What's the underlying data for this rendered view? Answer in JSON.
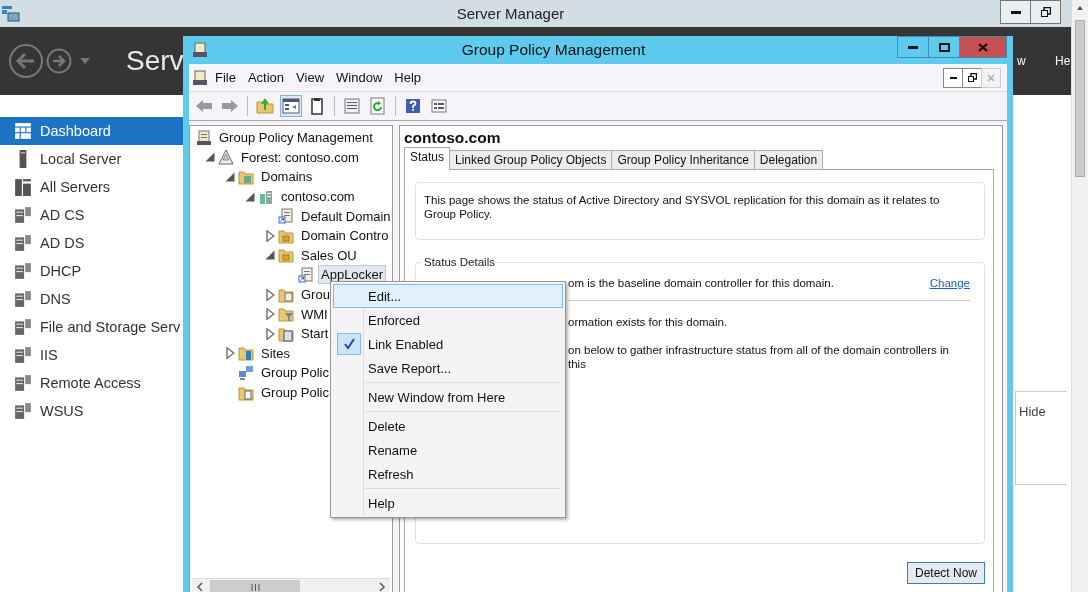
{
  "server_manager": {
    "title": "Server Manager",
    "header_title": "Serv",
    "menu_fragments": [
      "w",
      "He"
    ],
    "sidebar": [
      {
        "label": "Dashboard",
        "selected": true
      },
      {
        "label": "Local Server",
        "selected": false
      },
      {
        "label": "All Servers",
        "selected": false
      },
      {
        "label": "AD CS",
        "selected": false
      },
      {
        "label": "AD DS",
        "selected": false
      },
      {
        "label": "DHCP",
        "selected": false
      },
      {
        "label": "DNS",
        "selected": false
      },
      {
        "label": "File and Storage Serv",
        "selected": false
      },
      {
        "label": "IIS",
        "selected": false
      },
      {
        "label": "Remote Access",
        "selected": false
      },
      {
        "label": "WSUS",
        "selected": false
      }
    ],
    "hide_link": "Hide"
  },
  "gpm_window": {
    "title": "Group Policy Management",
    "menu": [
      "File",
      "Action",
      "View",
      "Window",
      "Help"
    ],
    "tree": [
      {
        "label": "Group Policy Management",
        "kind": "root",
        "selected": false,
        "children": [
          {
            "label": "Forest: contoso.com",
            "kind": "forest",
            "selected": false,
            "expanded": true,
            "children": [
              {
                "label": "Domains",
                "kind": "domains",
                "selected": false,
                "expanded": true,
                "children": [
                  {
                    "label": "contoso.com",
                    "kind": "domain",
                    "selected": false,
                    "expanded": true,
                    "children": [
                      {
                        "label": "Default Domain",
                        "kind": "gpo-link",
                        "selected": false
                      },
                      {
                        "label": "Domain Contro",
                        "kind": "ou",
                        "selected": false,
                        "expanded": false
                      },
                      {
                        "label": "Sales OU",
                        "kind": "ou",
                        "selected": false,
                        "expanded": true,
                        "children": [
                          {
                            "label": "AppLocker",
                            "kind": "gpo-link",
                            "selected": true
                          }
                        ]
                      },
                      {
                        "label": "Grou",
                        "kind": "gpos",
                        "selected": false,
                        "expanded": false
                      },
                      {
                        "label": "WMI",
                        "kind": "wmi",
                        "selected": false,
                        "expanded": false
                      },
                      {
                        "label": "Start",
                        "kind": "starter",
                        "selected": false,
                        "expanded": false
                      }
                    ]
                  }
                ]
              },
              {
                "label": "Sites",
                "kind": "sites",
                "selected": false,
                "expanded": false
              },
              {
                "label": "Group Polic",
                "kind": "modeling",
                "selected": false
              },
              {
                "label": "Group Polic",
                "kind": "results",
                "selected": false
              }
            ]
          }
        ]
      }
    ],
    "details": {
      "heading": "contoso.com",
      "tabs": [
        {
          "label": "Status",
          "selected": true
        },
        {
          "label": "Linked Group Policy Objects",
          "selected": false
        },
        {
          "label": "Group Policy Inheritance",
          "selected": false
        },
        {
          "label": "Delegation",
          "selected": false
        }
      ],
      "description": "This page shows the status of Active Directory and SYSVOL replication for this domain as it relates to Group Policy.",
      "status_details_title": "Status Details",
      "baseline_line": "om is the baseline domain controller for this domain.",
      "change_link": "Change",
      "lines": [
        "ormation exists for this domain.",
        "on below to gather infrastructure status from all of the domain controllers in this"
      ],
      "detect_button": "Detect Now"
    }
  },
  "context_menu": [
    {
      "kind": "item",
      "label": "Edit...",
      "selected": true,
      "checked": false
    },
    {
      "kind": "item",
      "label": "Enforced",
      "selected": false,
      "checked": false
    },
    {
      "kind": "item",
      "label": "Link Enabled",
      "selected": false,
      "checked": true
    },
    {
      "kind": "item",
      "label": "Save Report...",
      "selected": false,
      "checked": false
    },
    {
      "kind": "separator"
    },
    {
      "kind": "item",
      "label": "New Window from Here",
      "selected": false,
      "checked": false
    },
    {
      "kind": "separator"
    },
    {
      "kind": "item",
      "label": "Delete",
      "selected": false,
      "checked": false
    },
    {
      "kind": "item",
      "label": "Rename",
      "selected": false,
      "checked": false
    },
    {
      "kind": "item",
      "label": "Refresh",
      "selected": false,
      "checked": false
    },
    {
      "kind": "separator"
    },
    {
      "kind": "item",
      "label": "Help",
      "selected": false,
      "checked": false
    }
  ]
}
